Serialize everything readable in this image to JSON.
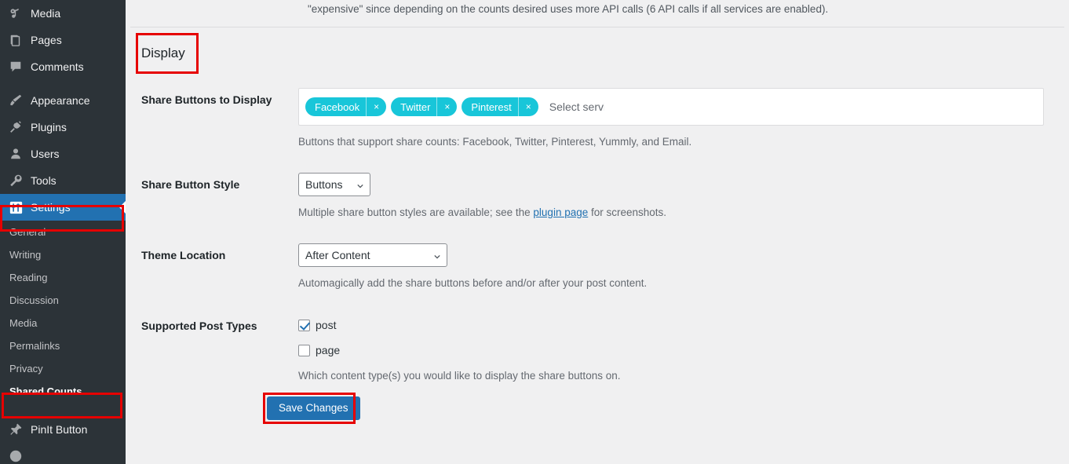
{
  "sidebar": {
    "menu": [
      {
        "label": "Media",
        "icon": "media-icon"
      },
      {
        "label": "Pages",
        "icon": "pages-icon"
      },
      {
        "label": "Comments",
        "icon": "comments-icon"
      },
      {
        "label": "Appearance",
        "icon": "appearance-icon"
      },
      {
        "label": "Plugins",
        "icon": "plugins-icon"
      },
      {
        "label": "Users",
        "icon": "users-icon"
      },
      {
        "label": "Tools",
        "icon": "tools-icon"
      },
      {
        "label": "Settings",
        "icon": "settings-icon"
      }
    ],
    "submenu": [
      {
        "label": "General"
      },
      {
        "label": "Writing"
      },
      {
        "label": "Reading"
      },
      {
        "label": "Discussion"
      },
      {
        "label": "Media"
      },
      {
        "label": "Permalinks"
      },
      {
        "label": "Privacy"
      },
      {
        "label": "Shared Counts"
      }
    ],
    "after": [
      {
        "label": "PinIt Button",
        "icon": "pin-icon"
      }
    ],
    "colors": {
      "background": "#2c3338",
      "current_item": "#2271b1",
      "highlight_outline": "#e60000"
    }
  },
  "content": {
    "intro_text": "\"expensive\" since depending on the counts desired uses more API calls (6 API calls if all services are enabled).",
    "section_title": "Display",
    "rows": {
      "share_buttons": {
        "label": "Share Buttons to Display",
        "tokens": [
          "Facebook",
          "Twitter",
          "Pinterest"
        ],
        "token_remove_glyph": "×",
        "placeholder": "Select services",
        "description": "Buttons that support share counts: Facebook, Twitter, Pinterest, Yummly, and Email.",
        "token_color": "#18c6d9"
      },
      "button_style": {
        "label": "Share Button Style",
        "value": "Buttons",
        "description_before": "Multiple share button styles are available; see the ",
        "description_link": "plugin page",
        "description_after": " for screenshots."
      },
      "theme_location": {
        "label": "Theme Location",
        "value": "After Content",
        "description": "Automagically add the share buttons before and/or after your post content."
      },
      "post_types": {
        "label": "Supported Post Types",
        "options": [
          {
            "label": "post",
            "checked": true
          },
          {
            "label": "page",
            "checked": false
          }
        ],
        "description": "Which content type(s) you would like to display the share buttons on."
      }
    },
    "save_button": "Save Changes"
  }
}
